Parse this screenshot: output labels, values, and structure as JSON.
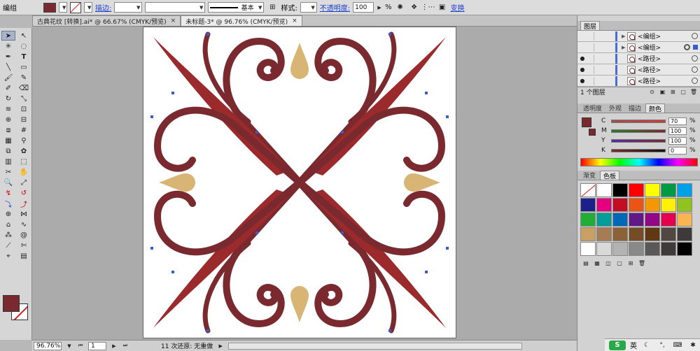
{
  "control": {
    "selection_label": "编组",
    "stroke_label": "描边:",
    "brush_label": "基本",
    "style_label": "样式:",
    "opacity_label": "不透明度:",
    "opacity_value": "100",
    "percent": "%",
    "transform_label": "变换",
    "fill_color": "#7a2a2e"
  },
  "tabs": [
    {
      "label": "古典花纹 [转换].ai* @ 66.67% (CMYK/预览)",
      "close": "×"
    },
    {
      "label": "未标题-3* @ 96.76% (CMYK/预览)",
      "close": "×"
    }
  ],
  "layers": {
    "title": "图层",
    "rows": [
      {
        "name": "<编组>"
      },
      {
        "name": "<编组>"
      },
      {
        "name": "<路径>"
      },
      {
        "name": "<路径>"
      },
      {
        "name": "<路径>"
      }
    ],
    "footer": "1 个图层"
  },
  "colorpanel": {
    "tabs": [
      "透明度",
      "外观",
      "描边",
      "颜色"
    ],
    "channels": [
      {
        "key": "C",
        "value": "70",
        "color": "#cc3b3b"
      },
      {
        "key": "M",
        "value": "100",
        "color": "#3a9a3a"
      },
      {
        "key": "Y",
        "value": "100",
        "color": "#6a2aa8"
      },
      {
        "key": "K",
        "value": "0",
        "color": "#444444"
      }
    ],
    "pct": "%"
  },
  "swatches": {
    "tabs": [
      "渐变",
      "色板"
    ],
    "colors": [
      "#ffffff",
      "#ffffff",
      "#000000",
      "#ff0000",
      "#ffff00",
      "#009944",
      "#00a0e9",
      "#1d2088",
      "#e4007f",
      "#c30d23",
      "#ea5514",
      "#f39800",
      "#fff100",
      "#8fc31f",
      "#22ac38",
      "#009e96",
      "#0068b7",
      "#601986",
      "#920783",
      "#e5004f",
      "#f8b551",
      "#c9a063",
      "#a67c52",
      "#8c6239",
      "#754c24",
      "#603813",
      "#534741",
      "#3d3a39",
      "#ffffff",
      "#d9d9d9",
      "#b3b3b3",
      "#898989",
      "#595757",
      "#3e3a39",
      "#000000"
    ]
  },
  "status": {
    "zoom": "96.76%",
    "page": "1",
    "message": "11 次还原: 无重做"
  },
  "taskbar": {
    "ime_logo": "S",
    "ime_lang": "英"
  },
  "artwork": {
    "dark": "#7a2a2e",
    "red": "#9b2a2d",
    "tan": "#d8b574",
    "accent": "#3a5bd0"
  }
}
